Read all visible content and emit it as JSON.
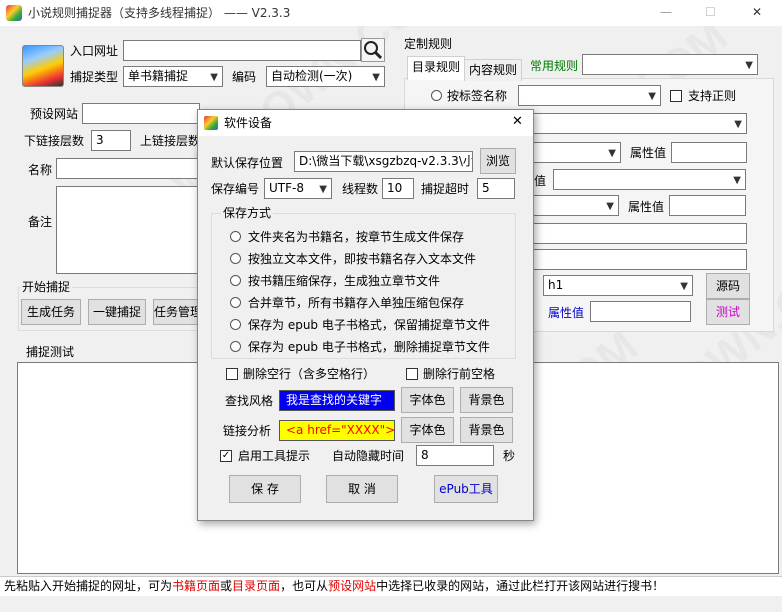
{
  "window": {
    "title": "小说规则捕捉器（支持多线程捕捉）  —— V2.3.3",
    "min_glyph": "—",
    "max_glyph": "☐",
    "close_glyph": "✕"
  },
  "main": {
    "url_label": "入口网址",
    "url_value": "",
    "capture_type_label": "捕捉类型",
    "capture_type_value": "单书籍捕捉",
    "encoding_label": "编码",
    "encoding_value": "自动检测(一次)",
    "preset_site_label": "预设网站",
    "preset_site_value": "",
    "down_depth_label": "下链接层数",
    "down_depth_value": "3",
    "up_depth_label": "上链接层数",
    "name_label": "名称",
    "name_value": "",
    "note_label": "备注",
    "note_value": "",
    "start_group_title": "开始捕捉",
    "gen_task_btn": "生成任务",
    "one_click_btn": "一键捕捉",
    "task_mgr_btn": "任务管理",
    "test_group_title": "捕捉测试",
    "status_prefix": "先粘贴入开始捕捉的网址，可为",
    "status_link1": "书籍页面",
    "status_or": "或",
    "status_link2": "目录页面",
    "status_mid": "，也可从",
    "status_link3": "预设网站",
    "status_suffix": "中选择已收录的网站，通过此栏打开该网站进行搜书！"
  },
  "rules": {
    "group_title": "定制规则",
    "tabs": [
      "目录规则",
      "内容规则",
      "常用规则"
    ],
    "active_tab": 0,
    "common_rules_value": "",
    "tag_name_label": "按标签名称",
    "tag_name_value": "",
    "regex_label": "支持正则",
    "attr_value_label_1": "属性值",
    "attr_value_label_2": "属性值",
    "value_label": "值",
    "h1_value": "h1",
    "source_btn": "源码",
    "attr_value_label_3": "属性值",
    "test_btn": "测试"
  },
  "dialog": {
    "title": "软件设备",
    "close_glyph": "✕",
    "save_path_label": "默认保存位置",
    "save_path_value": "D:\\微当下载\\xsgzbzq-v2.3.3\\小说",
    "browse_btn": "浏览",
    "save_enc_label": "保存编号",
    "save_enc_value": "UTF-8",
    "threads_label": "线程数",
    "threads_value": "10",
    "timeout_label": "捕捉超时",
    "timeout_value": "5",
    "save_mode_title": "保存方式",
    "save_modes": [
      "文件夹名为书籍名，按章节生成文件保存",
      "按独立文本文件，即按书籍名存入文本文件",
      "按书籍压缩保存，生成独立章节文件",
      "合并章节，所有书籍存入单独压缩包保存",
      "保存为 epub 电子书格式，保留捕捉章节文件",
      "保存为 epub 电子书格式，删除捕捉章节文件"
    ],
    "del_blank_label": "删除空行（含多空格行）",
    "del_leading_label": "删除行前空格",
    "find_style_label": "查找风格",
    "find_style_sample": "我是查找的关键字",
    "font_color_btn": "字体色",
    "bg_color_btn": "背景色",
    "link_label": "链接分析",
    "link_sample": "<a href=\"XXXX\">",
    "font_color_btn2": "字体色",
    "bg_color_btn2": "背景色",
    "tooltip_label": "启用工具提示",
    "tooltip_checked": "✓",
    "auto_hide_label": "自动隐藏时间",
    "auto_hide_value": "8",
    "seconds_label": "秒",
    "save_btn": "保 存",
    "cancel_btn": "取 消",
    "epub_btn": "ePub工具"
  },
  "watermark": "WEIDOWN.COM"
}
